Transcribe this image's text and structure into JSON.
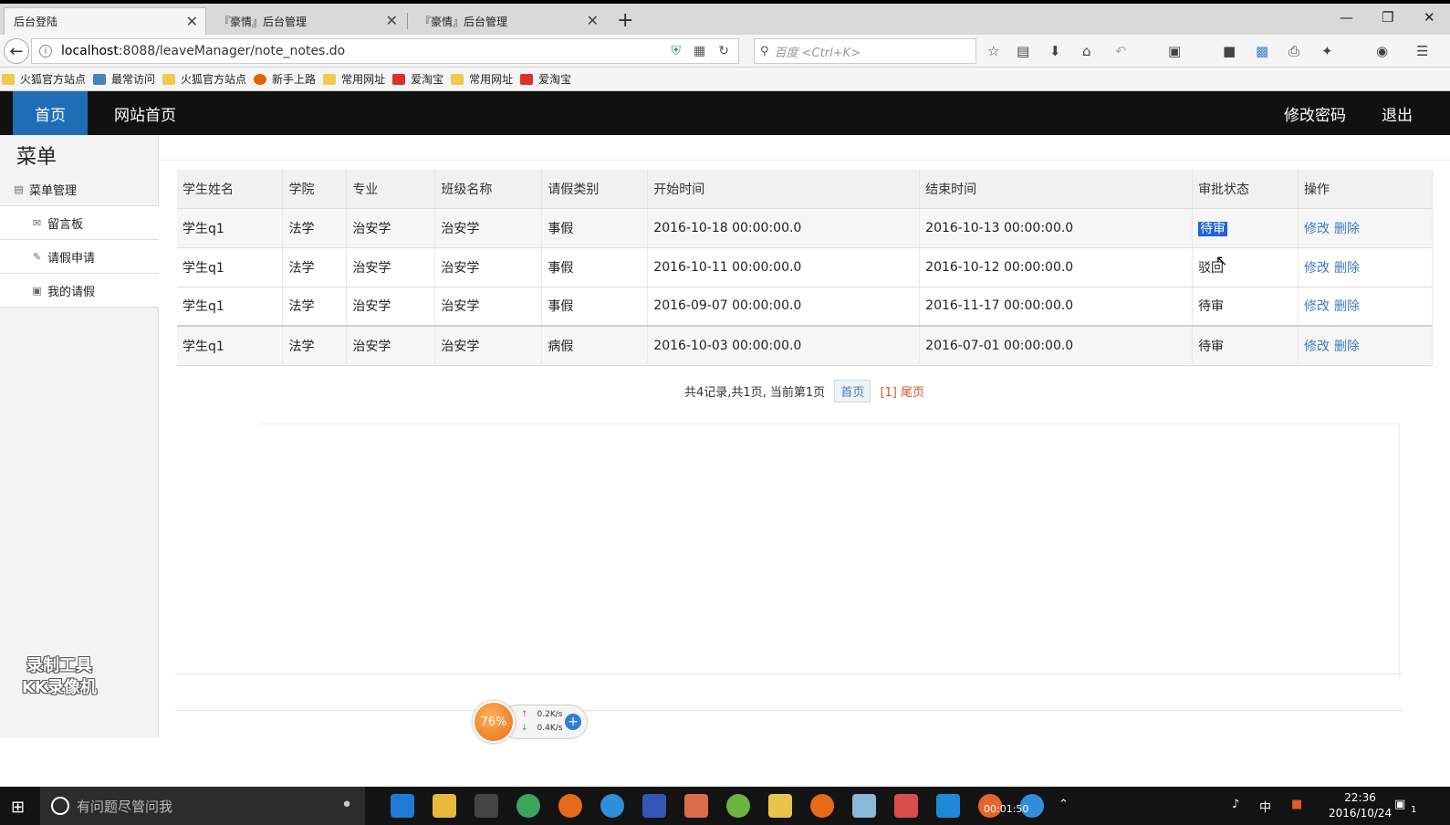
{
  "browser": {
    "tabs": [
      {
        "title": "后台登陆",
        "close": "✕"
      },
      {
        "title": "『豪情』后台管理",
        "close": "✕"
      },
      {
        "title": "『豪情』后台管理",
        "close": "✕"
      }
    ],
    "new_tab": "+",
    "url_host": "localhost",
    "url_rest": ":8088/leaveManager/note_notes.do",
    "search_placeholder": "百度 <Ctrl+K>"
  },
  "bookmarks": [
    {
      "label": "火狐官方站点",
      "icon": "folder-icon"
    },
    {
      "label": "最常访问",
      "icon": "star-folder-icon"
    },
    {
      "label": "火狐官方站点",
      "icon": "folder-icon"
    },
    {
      "label": "新手上路",
      "icon": "firefox-icon"
    },
    {
      "label": "常用网址",
      "icon": "folder-icon"
    },
    {
      "label": "爱淘宝",
      "icon": "taobao-icon"
    },
    {
      "label": "常用网址",
      "icon": "folder-icon"
    },
    {
      "label": "爱淘宝",
      "icon": "taobao-icon"
    }
  ],
  "header": {
    "home": "首页",
    "site_home": "网站首页",
    "change_password": "修改密码",
    "logout": "退出"
  },
  "sidebar": {
    "title": "菜单",
    "section": "菜单管理",
    "items": [
      {
        "label": "留言板",
        "icon": "mail-icon"
      },
      {
        "label": "请假申请",
        "icon": "pen-icon"
      },
      {
        "label": "我的请假",
        "icon": "image-icon"
      }
    ]
  },
  "table": {
    "columns": [
      "学生姓名",
      "学院",
      "专业",
      "班级名称",
      "请假类别",
      "开始时间",
      "结束时间",
      "审批状态",
      "操作"
    ],
    "rows": [
      {
        "name": "学生q1",
        "college": "法学",
        "major": "治安学",
        "class": "治安学",
        "type": "事假",
        "start": "2016-10-18 00:00:00.0",
        "end": "2016-10-13 00:00:00.0",
        "status": "待审",
        "edit": "修改",
        "delete": "删除"
      },
      {
        "name": "学生q1",
        "college": "法学",
        "major": "治安学",
        "class": "治安学",
        "type": "事假",
        "start": "2016-10-11 00:00:00.0",
        "end": "2016-10-12 00:00:00.0",
        "status": "驳回",
        "edit": "修改",
        "delete": "删除"
      },
      {
        "name": "学生q1",
        "college": "法学",
        "major": "治安学",
        "class": "治安学",
        "type": "事假",
        "start": "2016-09-07 00:00:00.0",
        "end": "2016-11-17 00:00:00.0",
        "status": "待审",
        "edit": "修改",
        "delete": "删除"
      },
      {
        "name": "学生q1",
        "college": "法学",
        "major": "治安学",
        "class": "治安学",
        "type": "病假",
        "start": "2016-10-03 00:00:00.0",
        "end": "2016-07-01 00:00:00.0",
        "status": "待审",
        "edit": "修改",
        "delete": "删除"
      }
    ]
  },
  "pagination": {
    "summary": "共4记录,共1页, 当前第1页",
    "first": "首页",
    "current": "[1]",
    "last": "尾页"
  },
  "watermark": {
    "line1": "录制工具",
    "line2": "KK录像机"
  },
  "speed_widget": {
    "percent": "76%",
    "up": "0.2K/s",
    "down": "0.4K/s"
  },
  "taskbar": {
    "search_placeholder": "有问题尽管问我",
    "time": "22:36",
    "date": "2016/10/24",
    "ime": "中",
    "recording": "00:01:50",
    "notifications": "1"
  }
}
